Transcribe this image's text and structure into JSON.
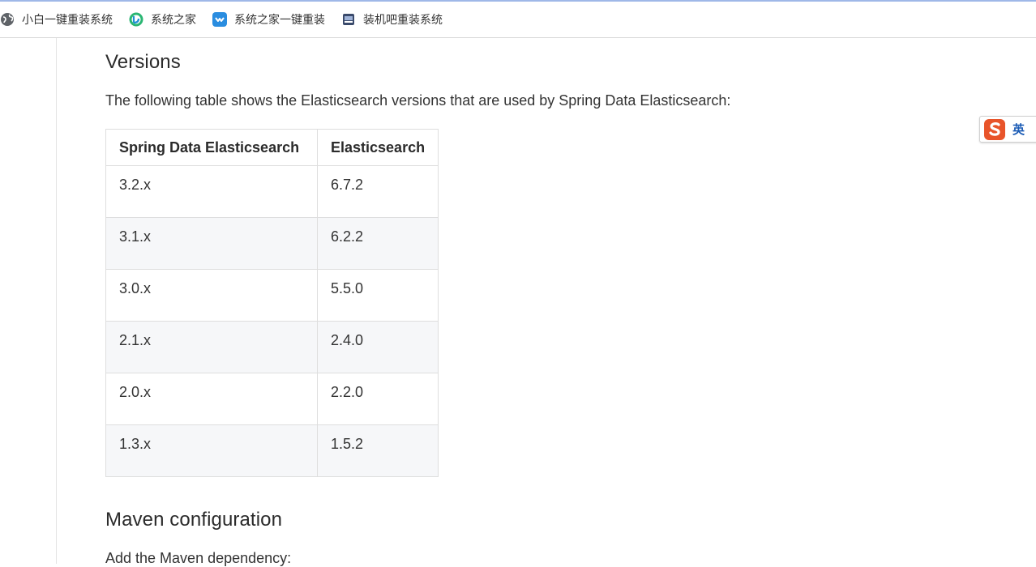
{
  "bookmarks": [
    {
      "label": "小白一键重装系统",
      "icon": "globe-icon"
    },
    {
      "label": "系统之家",
      "icon": "xitongzhijia-icon"
    },
    {
      "label": "系统之家一键重装",
      "icon": "xitongzhijia-reinstall-icon"
    },
    {
      "label": "装机吧重装系统",
      "icon": "zhuangjiba-icon"
    }
  ],
  "page": {
    "versions_heading": "Versions",
    "intro": "The following table shows the Elasticsearch versions that are used by Spring Data Elasticsearch:",
    "table": {
      "headers": [
        "Spring Data Elasticsearch",
        "Elasticsearch"
      ],
      "rows": [
        [
          "3.2.x",
          "6.7.2"
        ],
        [
          "3.1.x",
          "6.2.2"
        ],
        [
          "3.0.x",
          "5.5.0"
        ],
        [
          "2.1.x",
          "2.4.0"
        ],
        [
          "2.0.x",
          "2.2.0"
        ],
        [
          "1.3.x",
          "1.5.2"
        ]
      ]
    },
    "maven_heading": "Maven configuration",
    "next_paragraph": "Add the Maven dependency:"
  },
  "ime": {
    "mode": "英",
    "icon": "sogou-ime-icon"
  },
  "colors": {
    "accent_line": "#9fb8e8",
    "alt_row": "#f6f7f9",
    "ime_logo": "#e8542a"
  }
}
